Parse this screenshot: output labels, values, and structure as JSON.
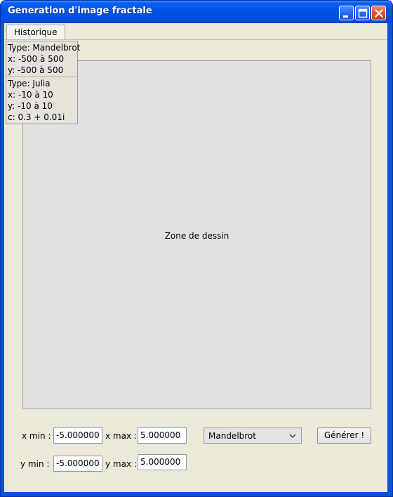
{
  "window": {
    "title": "Generation d'image fractale",
    "controls": [
      "minimize-icon",
      "maximize-icon",
      "close-icon"
    ],
    "accent_color": "#0a53d8"
  },
  "menu": {
    "items": [
      "Historique"
    ]
  },
  "history": {
    "entries": [
      {
        "type": "Type: Mandelbrot",
        "x": "x: -500 à 500",
        "y": "y: -500 à 500"
      },
      {
        "type": "Type: Julia",
        "x": "x: -10 à 10",
        "y": "y: -10 à 10",
        "c": "c: 0.3 + 0.01i"
      }
    ]
  },
  "canvas": {
    "label": "Zone de dessin"
  },
  "form": {
    "xmin_label": "x min :",
    "xmin_value": "-5.000000",
    "xmax_label": "x max :",
    "xmax_value": "5.000000",
    "ymin_label": "y min :",
    "ymin_value": "-5.000000",
    "ymax_label": "y max :",
    "ymax_value": "5.000000",
    "fractal_type": "Mandelbrot",
    "generate_label": "Générer !"
  }
}
